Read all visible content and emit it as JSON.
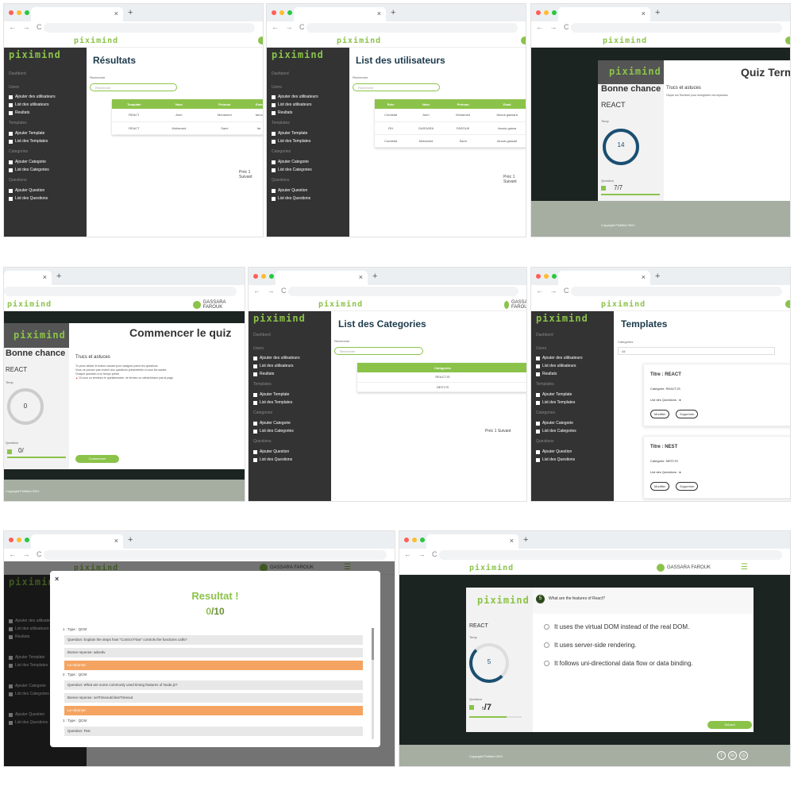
{
  "brand": {
    "logo": "piximind",
    "accent": "#8bc34a",
    "dark_sidebar": "#333333"
  },
  "browser": {
    "tab_close": "×",
    "new_tab": "+",
    "nav_glyphs": "← → C"
  },
  "user": {
    "name": "GASSARA FAROUK"
  },
  "sidebar": {
    "dashboard": "Dashbord",
    "users_head": "Users",
    "add_users": "Ajouter des utilisateurs",
    "list_users": "List des utilisateurs",
    "results": "Reultats",
    "templates_head": "Templates",
    "add_template": "Ajouter Template",
    "list_templates": "List des Templates",
    "categories_head": "Categories",
    "add_category": "Ajouter Categorie",
    "list_categories": "List des Categories",
    "questions_head": "Questions",
    "add_question": "Ajouter Question",
    "list_questions": "List des Questions"
  },
  "search": {
    "label": "Recherche",
    "placeholder": "Recherche"
  },
  "pager": {
    "prev": "Préc",
    "page": "1",
    "next": "Suivant"
  },
  "results_page": {
    "title": "Résultats",
    "headers": [
      "Template",
      "Nom",
      "Prénom",
      "Ema"
    ],
    "rows": [
      [
        "REACT",
        "Amri",
        "Mohamed",
        "farou"
      ],
      [
        "REACT",
        "Mohamed",
        "Sami",
        "far"
      ]
    ]
  },
  "users_page": {
    "title": "List des utilisateurs",
    "headers": [
      "Role",
      "Nom",
      "Prénom",
      "Emai"
    ],
    "rows": [
      [
        "Condidat",
        "Amri",
        "Mohamed",
        "farouk.gassara"
      ],
      [
        "RH",
        "GASSARA",
        "FAROUK",
        "farouk.gassa"
      ],
      [
        "Condidat",
        "Mohamed",
        "Sami",
        "farouk.gassari"
      ]
    ]
  },
  "quiz_end": {
    "title": "Quiz Term",
    "good_luck": "Bonne chance",
    "template": "REACT",
    "time_label": "Temp",
    "time_value": "14",
    "question_label": "Question",
    "question_count": "7/7",
    "tips_title": "Trucs et astuces",
    "tips_text": "Clique sur Terminer pour enregistrer vos reponses",
    "copyright": "Copyright PixMind 2021",
    "progress": 1.0
  },
  "quiz_start": {
    "title": "Commencer le quiz",
    "good_luck": "Bonne chance",
    "template": "REACT",
    "time_label": "Temp",
    "time_value": "0",
    "question_label": "Question",
    "question_count": "0/",
    "tips_title": "Trucs et astuces",
    "tips": [
      "Tu peux utiliser le button suivant pour naviguer parmi les questions",
      "Vous ne pouvez pas revenir aux questions précédentes si vous les sautez",
      "Chaque question a un temps précis",
      "Si vous ou terminez le questionnaire, ne fermez ou rafraîchissez pas la page"
    ],
    "start_button": "Commencer",
    "copyright": "Copyright PixMind 2021"
  },
  "categories_page": {
    "title": "List des Categories",
    "header": "Categories",
    "rows": [
      "REACTJS",
      "NESTJS"
    ]
  },
  "templates_page": {
    "title": "Templates",
    "filter_label": "Categories",
    "filter_value": "All",
    "cards": [
      {
        "title": "Titre : REACT",
        "category": "Catégorie: REACTJS",
        "questions": "List des Questions :",
        "edit": "Modifier",
        "delete": "Supprimer"
      },
      {
        "title": "Titre : NEST",
        "category": "Catégorie: NESTJS",
        "questions": "List des Questions :",
        "edit": "Modifier",
        "delete": "Supprimer"
      }
    ]
  },
  "result_modal": {
    "close": "×",
    "title": "Resultat !",
    "score": "0",
    "total": "/10",
    "groups": [
      {
        "type": "1 : Type : QCM",
        "question": "Question: Explain the steps how \"Control Flow\" controls the functions calls?",
        "good": "Bonne reponse: advedv",
        "answer": "La réponse:"
      },
      {
        "type": "2 : Type : QCM",
        "question": "Question: What are some commonly used timing features of Node.js?",
        "good": "Bonne reponse: setTimeout/clearTimeout",
        "answer": "La réponse:"
      },
      {
        "type": "1 : Type : QCM",
        "question": "Question: Test",
        "good": "",
        "answer": ""
      }
    ]
  },
  "quiz_question": {
    "number": "5",
    "question": "What are the features of React?",
    "template": "REACT",
    "time_label": "Temp",
    "time_value": "5",
    "question_label": "Question",
    "count_current": "5",
    "count_total": "/7",
    "progress": 0.714,
    "options": [
      "It uses the virtual DOM instead of the real DOM.",
      "It uses server-side rendering.",
      "It follows uni-directional data flow or data binding."
    ],
    "next_button": "Suivant",
    "copyright": "Copyright PixMind 2021",
    "social": [
      "f",
      "in",
      "◎"
    ]
  }
}
